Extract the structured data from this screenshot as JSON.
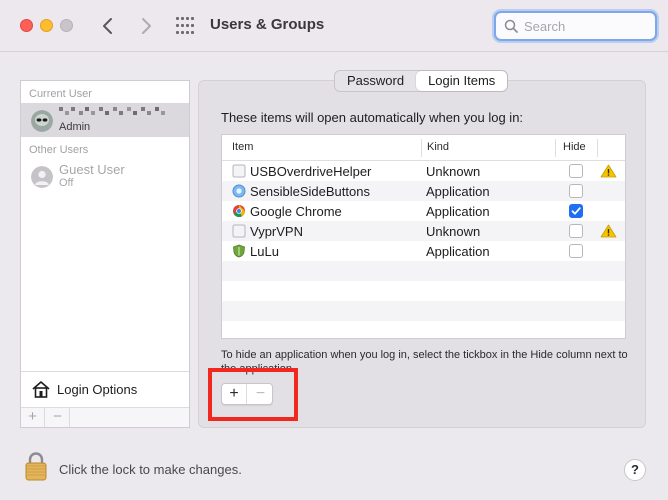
{
  "window": {
    "title": "Users & Groups",
    "search_placeholder": "Search"
  },
  "users": {
    "current_heading": "Current User",
    "current_user": {
      "name": "",
      "role": "Admin"
    },
    "other_heading": "Other Users",
    "guest": {
      "name": "Guest User",
      "status": "Off"
    },
    "login_options": "Login Options",
    "add": "+",
    "remove": "−"
  },
  "tabs": [
    {
      "label": "Password",
      "active": false
    },
    {
      "label": "Login Items",
      "active": true
    }
  ],
  "login_items": {
    "intro": "These items will open automatically when you log in:",
    "columns": {
      "item": "Item",
      "kind": "Kind",
      "hide": "Hide"
    },
    "rows": [
      {
        "name": "USBOverdriveHelper",
        "kind": "Unknown",
        "hide": false,
        "warning": true,
        "icon": "generic-app-icon"
      },
      {
        "name": "SensibleSideButtons",
        "kind": "Application",
        "hide": false,
        "warning": false,
        "icon": "sensible-side-buttons-icon"
      },
      {
        "name": "Google Chrome",
        "kind": "Application",
        "hide": true,
        "warning": false,
        "icon": "chrome-icon"
      },
      {
        "name": "VyprVPN",
        "kind": "Unknown",
        "hide": false,
        "warning": true,
        "icon": "generic-app-icon"
      },
      {
        "name": "LuLu",
        "kind": "Application",
        "hide": false,
        "warning": false,
        "icon": "lulu-shield-icon"
      }
    ],
    "hint": "To hide an application when you log in, select the tickbox in the Hide column next to the application.",
    "add": "+",
    "remove": "−"
  },
  "footer": {
    "lock_text": "Click the lock to make changes.",
    "help": "?"
  },
  "colors": {
    "accent": "#1f6ff0",
    "highlight": "#f0281f",
    "warning": "#f5c400"
  }
}
